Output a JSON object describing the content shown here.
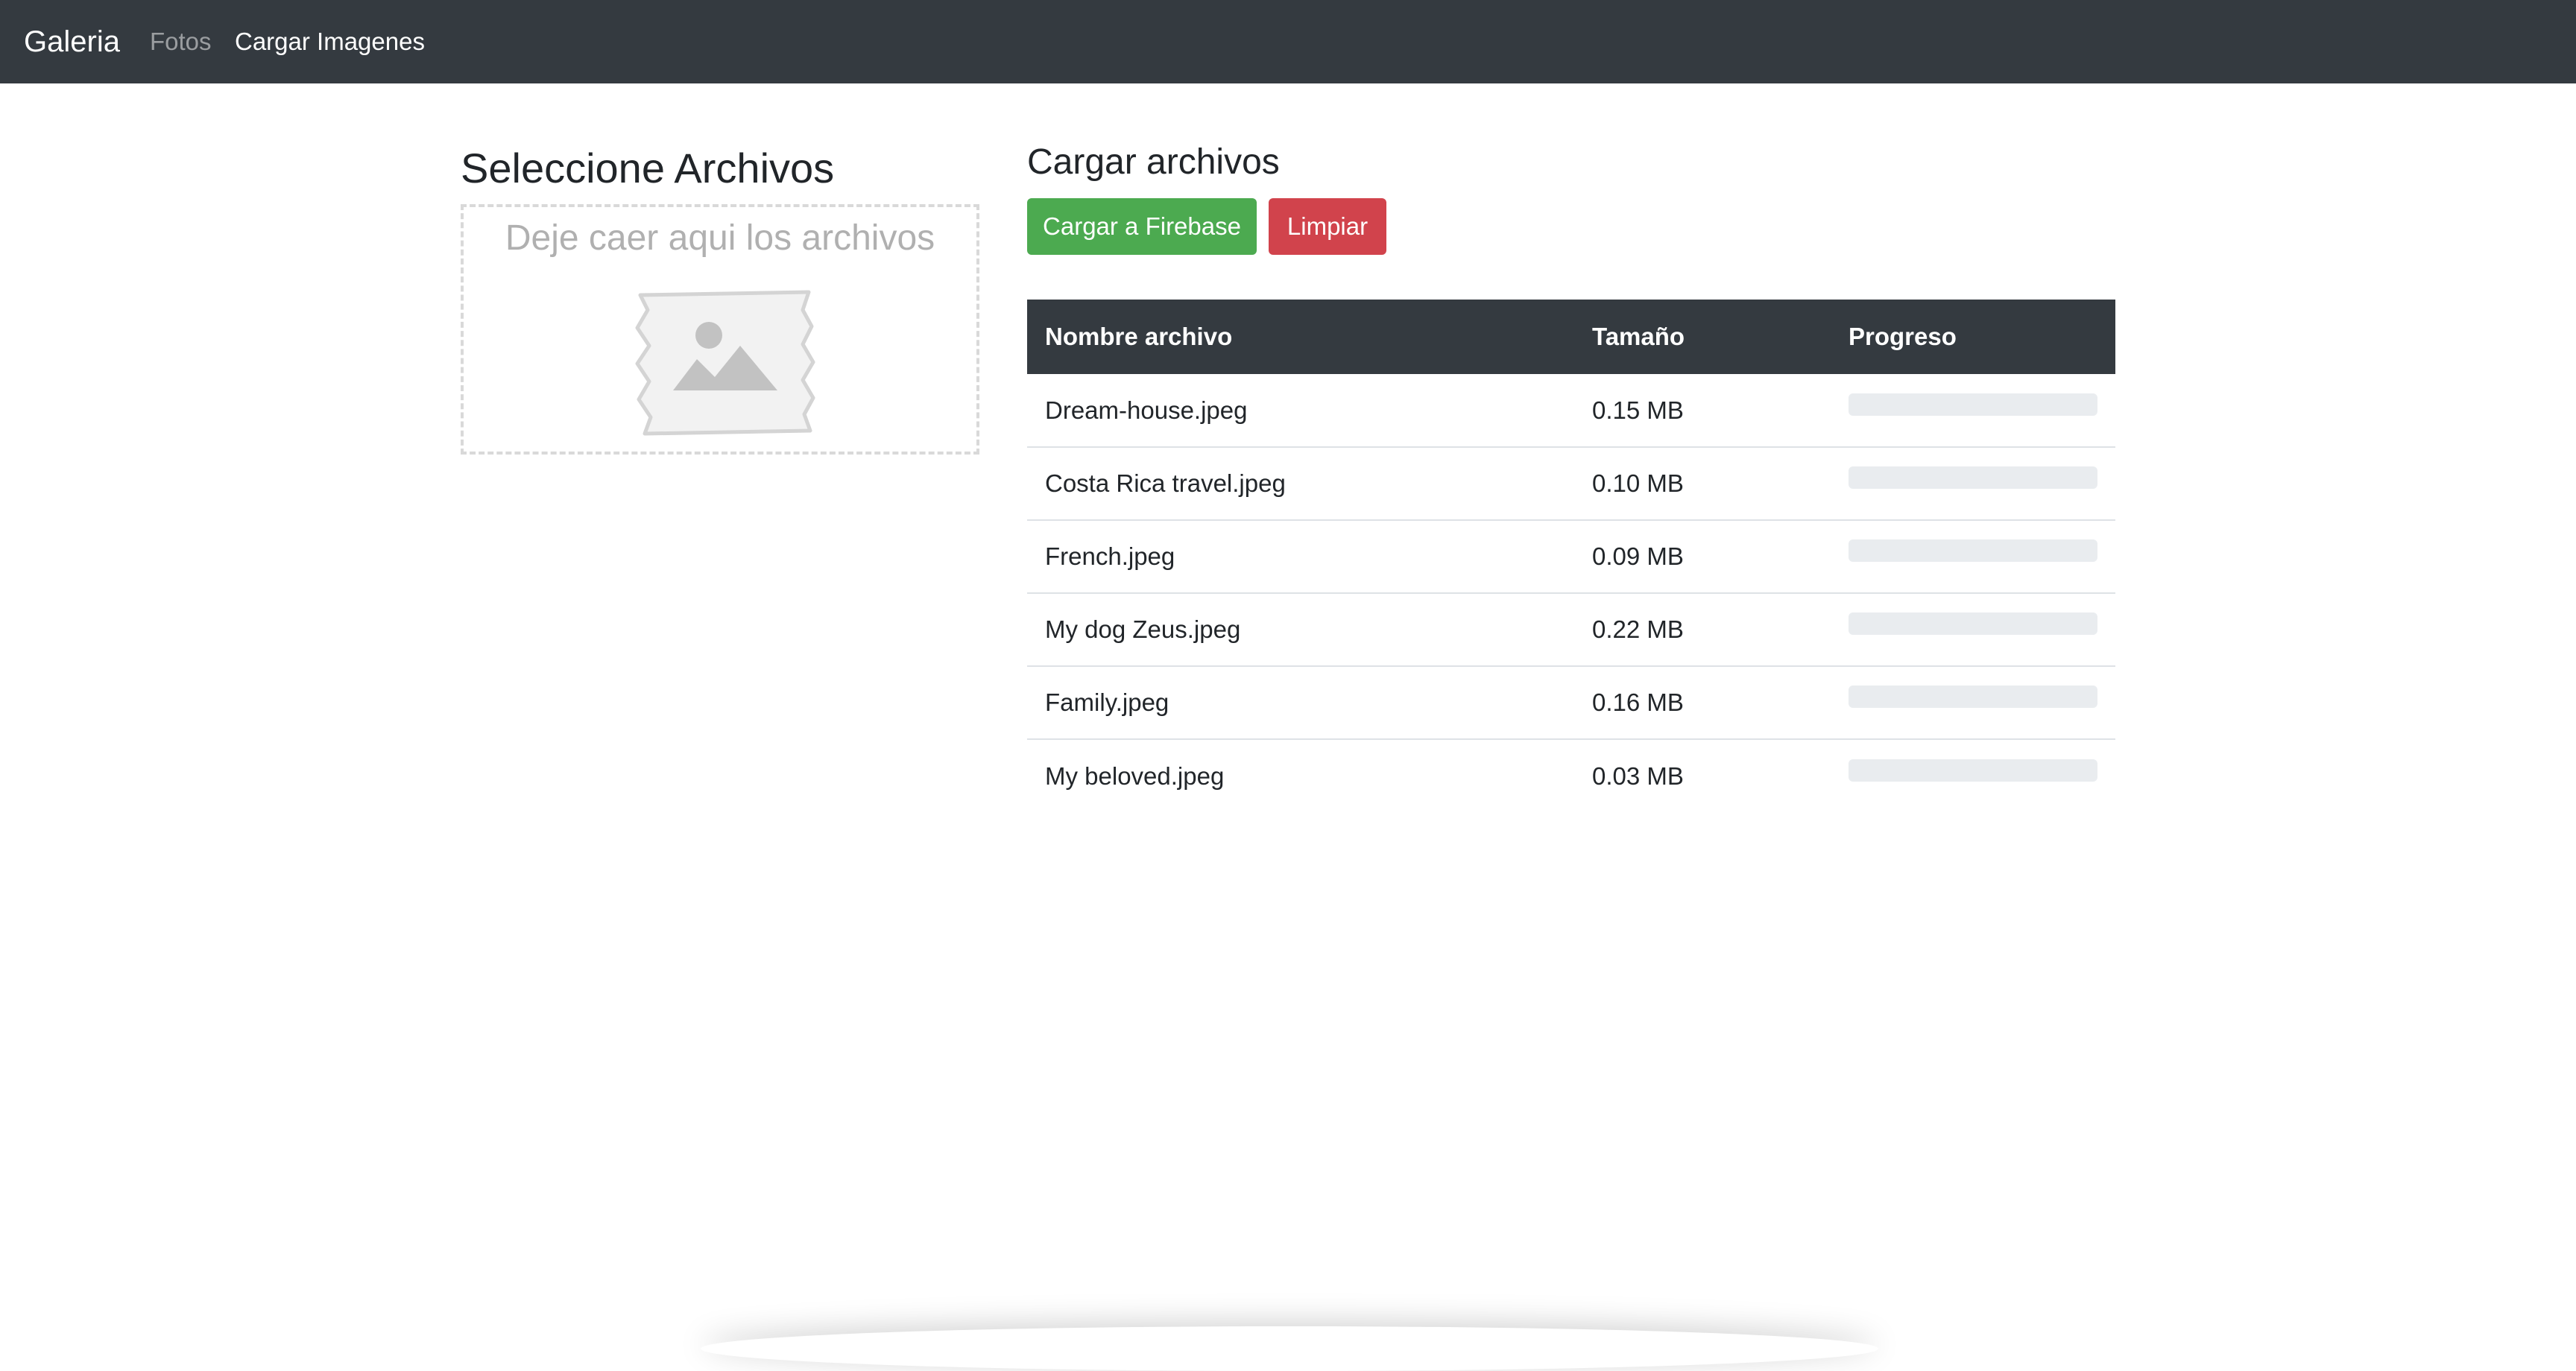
{
  "navbar": {
    "brand": "Galeria",
    "links": [
      {
        "label": "Fotos",
        "active": false
      },
      {
        "label": "Cargar Imagenes",
        "active": true
      }
    ]
  },
  "left_panel": {
    "title": "Seleccione Archivos",
    "dropzone_text": "Deje caer aqui los archivos",
    "dropzone_icon": "image-placeholder-icon"
  },
  "right_panel": {
    "title": "Cargar archivos",
    "buttons": {
      "upload_label": "Cargar a Firebase",
      "clear_label": "Limpiar"
    }
  },
  "table": {
    "headers": [
      "Nombre archivo",
      "Tamaño",
      "Progreso"
    ],
    "rows": [
      {
        "name": "Dream-house.jpeg",
        "size": "0.15 MB",
        "progress": 0
      },
      {
        "name": "Costa Rica travel.jpeg",
        "size": "0.10 MB",
        "progress": 0
      },
      {
        "name": "French.jpeg",
        "size": "0.09 MB",
        "progress": 0
      },
      {
        "name": "My dog Zeus.jpeg",
        "size": "0.22 MB",
        "progress": 0
      },
      {
        "name": "Family.jpeg",
        "size": "0.16 MB",
        "progress": 0
      },
      {
        "name": "My beloved.jpeg",
        "size": "0.03 MB",
        "progress": 0
      }
    ]
  },
  "colors": {
    "navbar_bg": "#343a40",
    "upload_button": "#4caa50",
    "clear_button": "#d1434c",
    "progress_track": "#e9ecef"
  }
}
